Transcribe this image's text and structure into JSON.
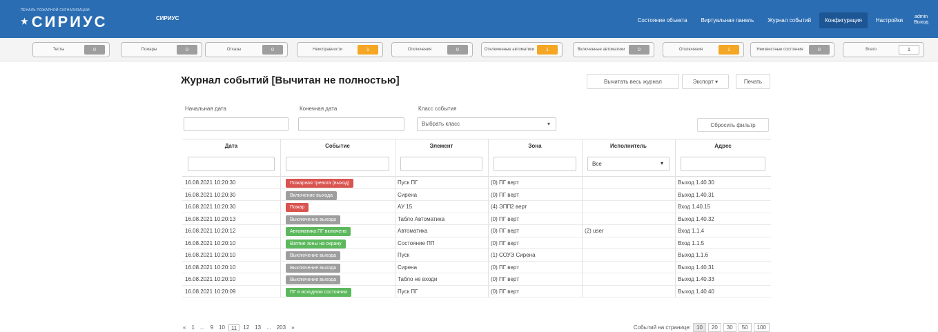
{
  "header": {
    "brand_small": "ПЕНАЛЬ ПОЖАРНОЙ СИГНАЛИЗАЦИИ",
    "brand_name": "СИРИУС",
    "app_name": "СИРИУС",
    "nav": [
      {
        "label": "Состояние объекта",
        "active": false
      },
      {
        "label": "Виртуальная панель",
        "active": false
      },
      {
        "label": "Журнал событий",
        "active": false
      },
      {
        "label": "Конфигурация",
        "active": true
      },
      {
        "label": "Настройки",
        "active": false
      }
    ],
    "user": {
      "name": "admin",
      "logout": "Выход"
    }
  },
  "counters": [
    {
      "label": "Тесты",
      "value": "0",
      "color": "gray"
    },
    {
      "label": "Пожары",
      "value": "0",
      "color": "gray"
    },
    {
      "label": "Отказы",
      "value": "0",
      "color": "gray"
    },
    {
      "label": "Неисправности",
      "value": "1",
      "color": "orange"
    },
    {
      "label": "Отключения",
      "value": "0",
      "color": "gray"
    },
    {
      "label": "Отключенные автоматики",
      "value": "1",
      "color": "orange"
    },
    {
      "label": "Включенные автоматики",
      "value": "0",
      "color": "gray"
    },
    {
      "label": "Отключения",
      "value": "1",
      "color": "orange"
    },
    {
      "label": "Неизвестные состояния",
      "value": "0",
      "color": "gray"
    },
    {
      "label": "Всего",
      "value": "1",
      "color": "white"
    }
  ],
  "journal": {
    "title": "Журнал событий [Вычитан не полностью]",
    "read_all_label": "Вычитать весь журнал",
    "export_label": "Экспорт",
    "print_label": "Печать",
    "reset_filters_label": "Сбросить фильтр",
    "filters": {
      "start_date_label": "Начальная дата",
      "end_date_label": "Конечная дата",
      "class_label": "Класс события",
      "class_value": "Выбрать класс"
    },
    "columns": [
      "Дата",
      "Событие",
      "Элемент",
      "Зона",
      "Исполнитель",
      "Адрес"
    ],
    "user_filter_value": "Все",
    "rows": [
      {
        "date": "16.08.2021",
        "time": "10:20:30",
        "event": "Пожарная тревога (выход)",
        "event_color": "#d9534f",
        "element": "Пуск ПГ",
        "zone": "(0) ПГ верт",
        "user": "",
        "address": "Выход 1.40.30"
      },
      {
        "date": "16.08.2021",
        "time": "10:20:30",
        "event": "Включение выхода",
        "event_color": "#9e9e9e",
        "element": "Сирена",
        "zone": "(0) ПГ верт",
        "user": "",
        "address": "Выход 1.40.31"
      },
      {
        "date": "16.08.2021",
        "time": "10:20:30",
        "event": "Пожар",
        "event_color": "#d9534f",
        "element": "АУ 15",
        "zone": "(4) ЭПП2 верт",
        "user": "",
        "address": "Вход 1.40.15"
      },
      {
        "date": "16.08.2021",
        "time": "10:20:13",
        "event": "Выключение выхода",
        "event_color": "#9e9e9e",
        "element": "Табло Автоматика",
        "zone": "(0) ПГ верт",
        "user": "",
        "address": "Выход 1.40.32"
      },
      {
        "date": "16.08.2021",
        "time": "10:20:12",
        "event": "Автоматика ПГ включена",
        "event_color": "#5cb85c",
        "element": "Автоматика",
        "zone": "(0) ПГ верт",
        "user": "(2) user",
        "address": "Вход 1.1.4"
      },
      {
        "date": "16.08.2021",
        "time": "10:20:10",
        "event": "Взятие зоны на охрану",
        "event_color": "#5cb85c",
        "element": "Состояние ПП",
        "zone": "(0) ПГ верт",
        "user": "",
        "address": "Вход 1.1.5"
      },
      {
        "date": "16.08.2021",
        "time": "10:20:10",
        "event": "Выключение выхода",
        "event_color": "#9e9e9e",
        "element": "Пуск",
        "zone": "(1) СОУЭ Сирена",
        "user": "",
        "address": "Выход 1.1.6"
      },
      {
        "date": "16.08.2021",
        "time": "10:20:10",
        "event": "Выключение выхода",
        "event_color": "#9e9e9e",
        "element": "Сирена",
        "zone": "(0) ПГ верт",
        "user": "",
        "address": "Выход 1.40.31"
      },
      {
        "date": "16.08.2021",
        "time": "10:20:10",
        "event": "Выключение выхода",
        "event_color": "#9e9e9e",
        "element": "Табло не входи",
        "zone": "(0) ПГ верт",
        "user": "",
        "address": "Выход 1.40.33"
      },
      {
        "date": "16.08.2021",
        "time": "10:20:09",
        "event": "ПГ в исходном состоянии",
        "event_color": "#5cb85c",
        "element": "Пуск ПГ",
        "zone": "(0) ПГ верт",
        "user": "",
        "address": "Выход 1.40.40"
      }
    ],
    "pagination": {
      "pages": [
        "«",
        "1",
        "...",
        "9",
        "10",
        "11",
        "12",
        "13",
        "...",
        "203",
        "»"
      ],
      "active": "11",
      "per_page_label": "Событий на странице:",
      "per_page_options": [
        "10",
        "20",
        "30",
        "50",
        "100"
      ],
      "per_page_active": "10"
    }
  }
}
